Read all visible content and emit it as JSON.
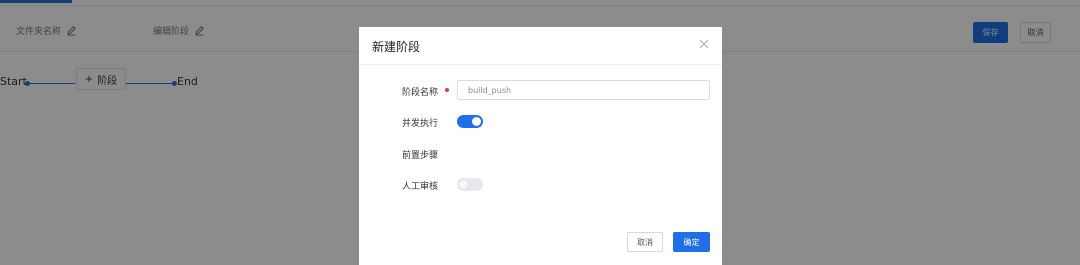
{
  "background": {
    "fields": {
      "file_label": "文件夹名称",
      "action_label": "编辑阶段"
    },
    "header_buttons": {
      "save_label": "保存",
      "cancel_label": "取消"
    },
    "pipeline": {
      "start_label": "Start",
      "add_stage_plus": "+",
      "add_stage_label": "阶段",
      "end_label": "End"
    }
  },
  "modal": {
    "title": "新建阶段",
    "close_icon": "close-icon",
    "form": {
      "name_label": "阶段名称",
      "name_value": "build_push",
      "concurrent_label": "并发执行",
      "concurrent_enabled": true,
      "pre_steps_label": "前置步骤",
      "manual_review_label": "人工审核",
      "manual_review_enabled": false
    },
    "footer": {
      "cancel_label": "取消",
      "confirm_label": "确定"
    }
  },
  "colors": {
    "primary": "#1f6fe8",
    "required": "#e53935",
    "overlay": "rgba(0,0,0,0.45)"
  }
}
